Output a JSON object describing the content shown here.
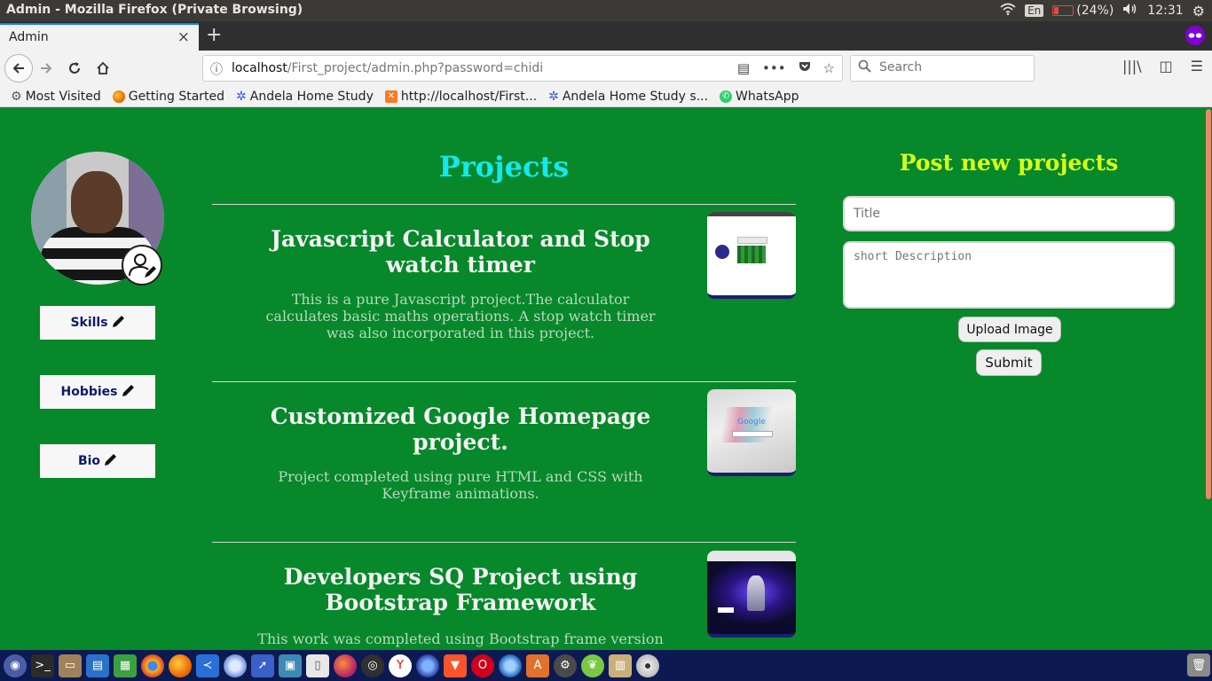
{
  "os": {
    "window_title": "Admin - Mozilla Firefox (Private Browsing)",
    "keyboard_layout": "En",
    "battery": "(24%)",
    "clock": "12:31"
  },
  "browser": {
    "tab_title": "Admin",
    "tab_close": "×",
    "new_tab": "+",
    "url_host": "localhost",
    "url_path": "/First_project/admin.php?password=chidi",
    "search_placeholder": "Search",
    "bookmarks": [
      {
        "label": "Most Visited",
        "icon": "gear-icon"
      },
      {
        "label": "Getting Started",
        "icon": "firefox-icon"
      },
      {
        "label": "Andela Home Study",
        "icon": "andela-icon"
      },
      {
        "label": "http://localhost/First...",
        "icon": "xampp-icon"
      },
      {
        "label": "Andela Home Study s...",
        "icon": "andela-icon"
      },
      {
        "label": "WhatsApp",
        "icon": "whatsapp-icon"
      }
    ]
  },
  "sidebar": {
    "buttons": [
      {
        "label": "Skills"
      },
      {
        "label": "Hobbies"
      },
      {
        "label": "Bio"
      }
    ]
  },
  "projects": {
    "heading": "Projects",
    "items": [
      {
        "title": "Javascript Calculator and Stop watch timer",
        "description": "This is a pure Javascript project.The calculator calculates basic maths operations. A stop watch timer was also incorporated in this project."
      },
      {
        "title": "Customized Google Homepage project.",
        "description": "Project completed using pure HTML and CSS with Keyframe animations.",
        "thumb_logo": "Google"
      },
      {
        "title": "Developers SQ Project using Bootstrap Framework",
        "description": "This work was completed using Bootstrap frame version"
      }
    ]
  },
  "form": {
    "heading": "Post new projects",
    "title_placeholder": "Title",
    "description_placeholder": "short Description",
    "upload_label": "Upload Image",
    "submit_label": "Submit"
  },
  "colors": {
    "page_bg": "#07882a",
    "projects_heading": "#14e8f0",
    "form_heading": "#d6ff1a",
    "sidebar_button_text": "#0d1a6b",
    "taskbar_bg": "#0d1a52"
  },
  "taskbar": {
    "icons": [
      "dash-icon",
      "terminal-icon",
      "files-icon",
      "writer-icon",
      "calc-icon",
      "chrome-icon",
      "firefox-icon",
      "vscode-icon",
      "chromium-icon",
      "synaptic-icon",
      "app-icon",
      "document-icon",
      "firefox-dev-icon",
      "obs-icon",
      "yandex-icon",
      "firefox-nightly-icon",
      "brave-icon",
      "opera-icon",
      "browser-icon",
      "software-center-icon",
      "settings-icon",
      "leaf-icon",
      "archive-icon",
      "disc-icon"
    ],
    "trash_icon": "trash-icon"
  }
}
